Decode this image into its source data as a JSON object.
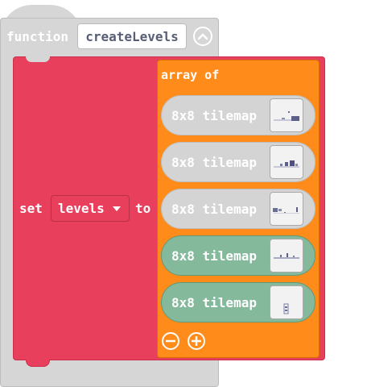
{
  "function_block": {
    "keyword": "function",
    "name": "createLevels"
  },
  "set_block": {
    "set_label": "set",
    "variable": "levels",
    "to_label": "to"
  },
  "array_block": {
    "label": "array of",
    "items": [
      {
        "label": "8x8 tilemap",
        "highlighted": false
      },
      {
        "label": "8x8 tilemap",
        "highlighted": false
      },
      {
        "label": "8x8 tilemap",
        "highlighted": false
      },
      {
        "label": "8x8 tilemap",
        "highlighted": true
      },
      {
        "label": "8x8 tilemap",
        "highlighted": true
      }
    ]
  },
  "colors": {
    "function_block": "#d6d6d6",
    "set_block": "#e83f5c",
    "array_block": "#ff8c1a",
    "tilemap_grey": "#d4d4d4",
    "tilemap_green": "#84b99b"
  },
  "icons": {
    "collapse": "chevron-up-icon",
    "dropdown": "caret-down-icon",
    "remove_item": "minus-circle-icon",
    "add_item": "plus-circle-icon"
  }
}
